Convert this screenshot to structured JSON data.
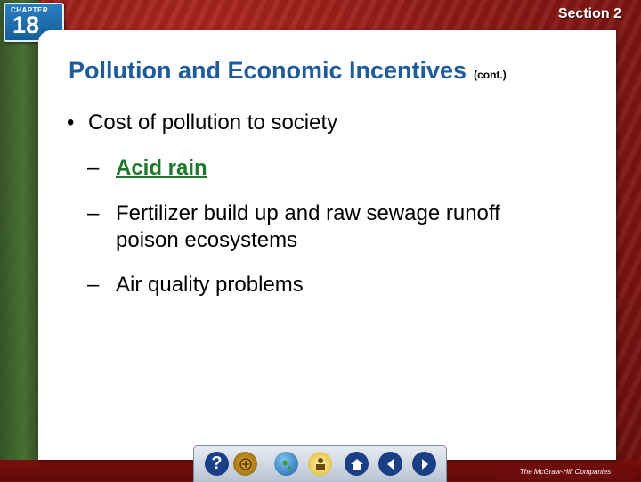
{
  "header": {
    "chapter_word": "CHAPTER",
    "chapter_number": "18",
    "section_label": "Section 2"
  },
  "slide": {
    "title": "Pollution and Economic Incentives",
    "title_suffix": "(cont.)",
    "bullet": "Cost of pollution to society",
    "dash": "–",
    "bullet_marker": "•",
    "sub_items": [
      {
        "text": "Acid rain",
        "is_link": true
      },
      {
        "text_line1": "Fertilizer build up and raw sewage runoff",
        "text_line2": "poison ecosystems"
      },
      {
        "text": "Air quality problems"
      }
    ]
  },
  "toolbar": {
    "buttons": [
      "help-icon",
      "resource-icon",
      "globe-icon",
      "figure-icon",
      "home-icon",
      "back-icon",
      "forward-icon"
    ],
    "help_glyph": "?"
  },
  "footer": {
    "publisher": "The McGraw-Hill Companies"
  },
  "colors": {
    "title": "#1f5c9a",
    "link": "#1e7a2a",
    "background": "#8e1a16",
    "nav_button": "#1b3f86"
  }
}
